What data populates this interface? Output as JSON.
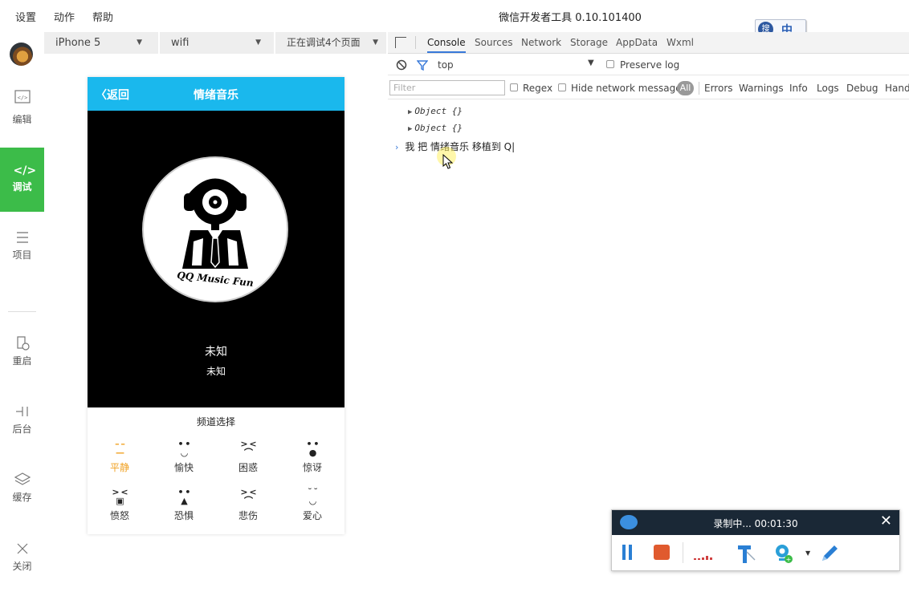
{
  "menubar": {
    "items": [
      "设置",
      "动作",
      "帮助"
    ],
    "title": "微信开发者工具 0.10.101400"
  },
  "ime": {
    "text": "中"
  },
  "sidebar": {
    "items": [
      {
        "label": "编辑",
        "icon": "code-box-icon"
      },
      {
        "label": "调试",
        "icon": "code-icon"
      },
      {
        "label": "项目",
        "icon": "menu-icon"
      },
      {
        "label": "重启",
        "icon": "restart-icon"
      },
      {
        "label": "后台",
        "icon": "background-icon"
      },
      {
        "label": "缓存",
        "icon": "layers-icon"
      },
      {
        "label": "关闭",
        "icon": "close-icon"
      }
    ],
    "active": 1,
    "active_color": "#3cbc49"
  },
  "simulator": {
    "device": "iPhone 5",
    "network": "wifi",
    "status": "正在调试4个页面"
  },
  "phone": {
    "nav_back": "返回",
    "nav_title": "情绪音乐",
    "nav_color": "#1ab8ed",
    "disc_text": "QQ Music Fun",
    "song_title": "未知",
    "song_artist": "未知",
    "channel_title": "频道选择",
    "moods": [
      {
        "label": "平静",
        "face": "– –\n—",
        "active": true
      },
      {
        "label": "愉快",
        "face": "• •\n◡",
        "active": false
      },
      {
        "label": "困惑",
        "face": "> <\n⌒",
        "active": false
      },
      {
        "label": "惊讶",
        "face": "• •\n●",
        "active": false
      },
      {
        "label": "愤怒",
        "face": "> <\n▣",
        "active": false
      },
      {
        "label": "恐惧",
        "face": "• •\n▲",
        "active": false
      },
      {
        "label": "悲伤",
        "face": "> <\n⌒",
        "active": false
      },
      {
        "label": "爱心",
        "face": "˘ ˘\n◡",
        "active": false
      }
    ],
    "accent": "#f0a020"
  },
  "devtools": {
    "tabs": [
      "Console",
      "Sources",
      "Network",
      "Storage",
      "AppData",
      "Wxml"
    ],
    "active_tab": "Console",
    "context": "top",
    "preserve_log": "Preserve log",
    "filter_placeholder": "Filter",
    "regex": "Regex",
    "hide_network": "Hide network messages",
    "all": "All",
    "levels": [
      "Errors",
      "Warnings",
      "Info",
      "Logs",
      "Debug",
      "Hand"
    ],
    "logs": [
      "Object {}",
      "Object {}"
    ],
    "input_text": "我 把  情绪音乐   移植到 Q"
  },
  "recorder": {
    "title": "录制中... 00:01:30"
  }
}
